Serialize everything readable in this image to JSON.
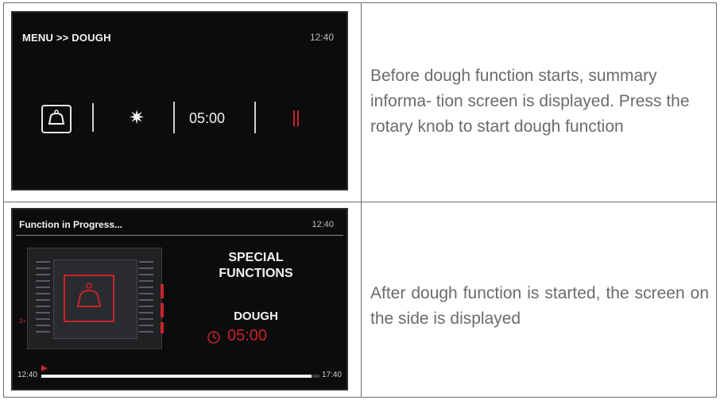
{
  "row1": {
    "screen": {
      "title": "MENU >> DOUGH",
      "clock": "12:40",
      "icons": [
        "dough-icon",
        "light-icon",
        "pause-icon"
      ],
      "time": "05:00"
    },
    "description": "Before dough function starts, summary informa- tion screen is displayed. Press the rotary knob to start dough function"
  },
  "row2": {
    "screen": {
      "title": "Function in Progress...",
      "clock": "12:40",
      "heading_line1": "SPECIAL",
      "heading_line2": "FUNCTIONS",
      "function_name": "DOUGH",
      "timer": "05:00",
      "level_label": "2+",
      "progress_start": "12:40",
      "progress_end": "17:40",
      "progress_fraction": 0.97
    },
    "description": "After dough function is started, the screen on the side is displayed"
  },
  "colors": {
    "screen_bg": "#0c0c0e",
    "accent_red": "#c8242b",
    "text_gray": "#6b6b6b"
  }
}
